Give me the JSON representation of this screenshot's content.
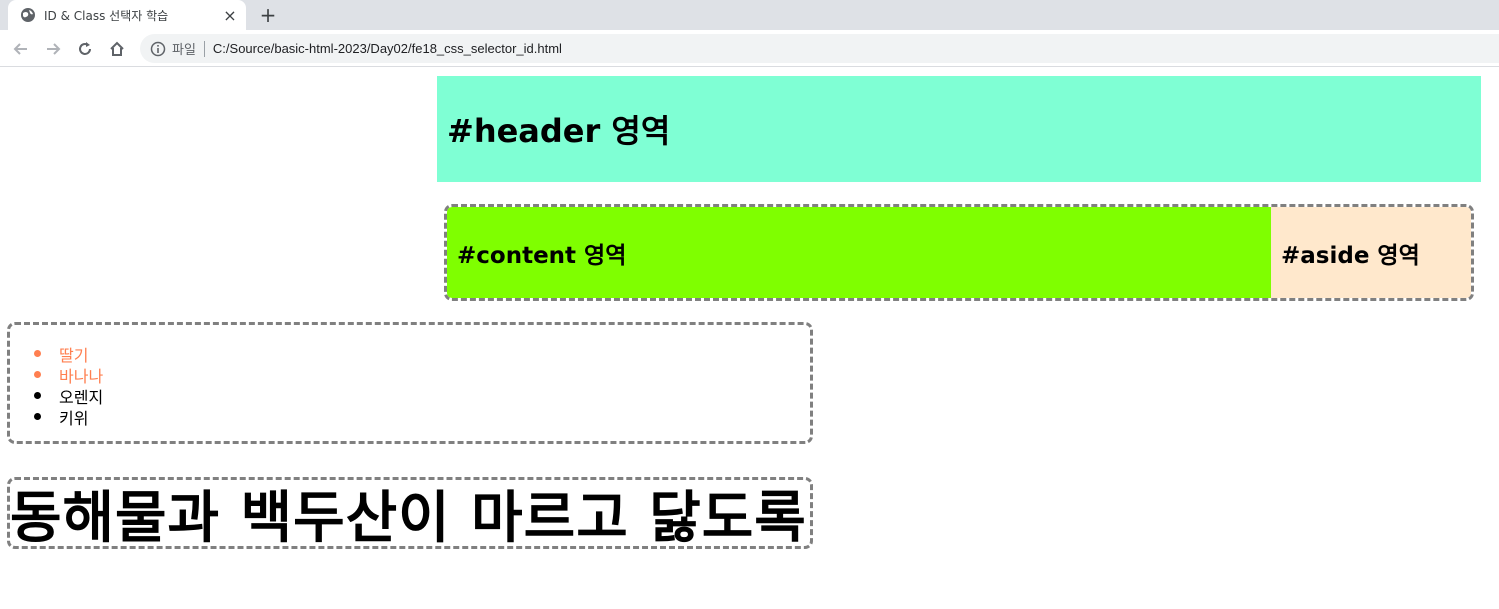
{
  "browser": {
    "tab_title": "ID & Class 선택자 학습",
    "tab_close": "×",
    "new_tab": "+",
    "address_scheme": "파일",
    "address_url": "C:/Source/basic-html-2023/Day02/fe18_css_selector_id.html"
  },
  "page": {
    "header_text": "#header 영역",
    "content_text": "#content 영역",
    "aside_text": "#aside 영역",
    "fruits": [
      {
        "label": "딸기",
        "highlight": true
      },
      {
        "label": "바나나",
        "highlight": true
      },
      {
        "label": "오렌지",
        "highlight": false
      },
      {
        "label": "키위",
        "highlight": false
      }
    ],
    "slogan": "동해물과 백두산이 마르고 닳도록"
  },
  "colors": {
    "header_bg": "#7fffd4",
    "content_bg": "#7fff00",
    "aside_bg": "#ffe8cc",
    "highlight_text": "#ff7f50",
    "dashed_border": "#808080"
  }
}
